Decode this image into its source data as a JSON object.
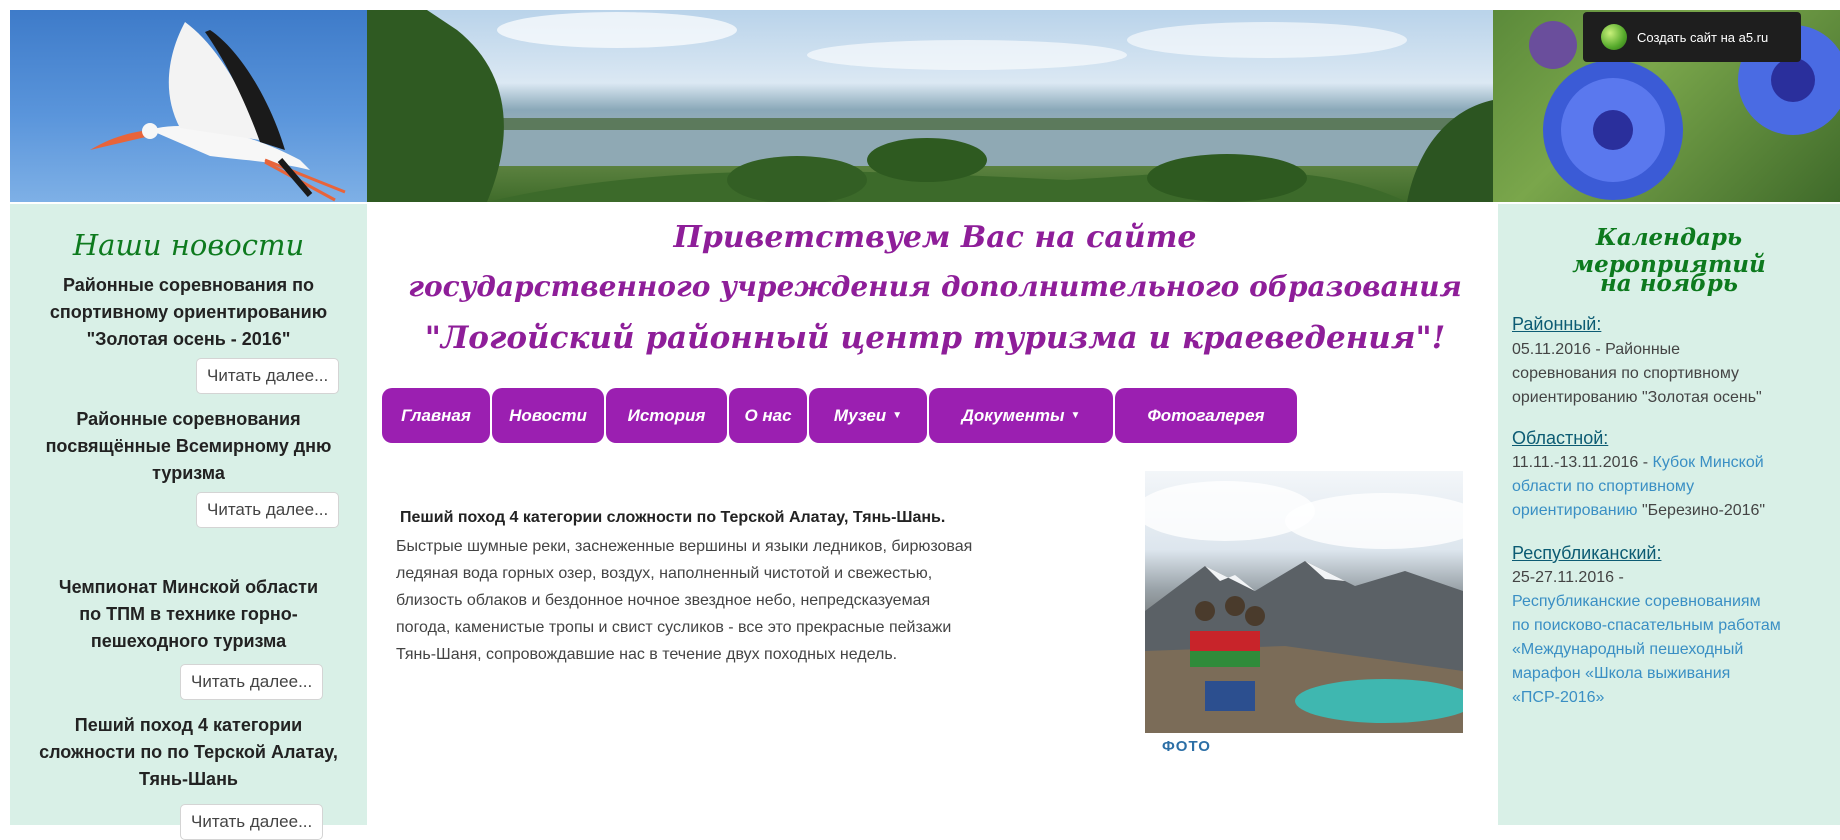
{
  "header": {
    "create_site_label": "Создать сайт на a5.ru"
  },
  "left": {
    "title": "Наши новости",
    "read_more": "Читать далее...",
    "news": [
      {
        "line1": "Районные соревнования по",
        "line2": "спортивному ориентированию",
        "line3": "\"Золотая осень - 2016\""
      },
      {
        "line1": "Районные соревнования",
        "line2": "посвящённые Всемирному дню",
        "line3": "туризма"
      },
      {
        "line1": "Чемпионат Минской области",
        "line2": "по ТПМ в технике горно-",
        "line3": "пешеходного туризма"
      },
      {
        "line1": "Пеший поход 4 категории",
        "line2": "сложности по по Терской Алатау,",
        "line3": "Тянь-Шань"
      }
    ]
  },
  "welcome": {
    "line1": "Приветствуем Вас на  сайте",
    "line2": "государственного учреждения дополнительного образования",
    "line3": "\"Логойский районный центр туризма и краеведения\"!"
  },
  "nav": {
    "items": [
      {
        "label": "Главная"
      },
      {
        "label": "Новости"
      },
      {
        "label": "История"
      },
      {
        "label": "О нас"
      },
      {
        "label": "Музеи"
      },
      {
        "label": "Документы"
      },
      {
        "label": "Фотогалерея"
      }
    ]
  },
  "article": {
    "title": "Пеший поход 4 категории сложности по Терской Алатау, Тянь-Шань.",
    "lines": [
      "Быстрые шумные реки, заснеженные вершины и языки ледников, бирюзовая",
      "ледяная вода горных озер, воздух, наполненный чистотой и свежестью,",
      "близость облаков и бездонное ночное звездное небо, непредсказуемая",
      "погода, каменистые тропы и свист сусликов - все это прекрасные пейзажи",
      "Тянь-Шаня, сопровождавшие нас в течение двух походных недель."
    ],
    "photo_caption": "ФОТО"
  },
  "calendar": {
    "title_line1": "Календарь мероприятий",
    "title_line2": "на ноябрь",
    "sections": [
      {
        "heading": "Районный:",
        "lines": [
          {
            "text": "05.11.2016 - Районные",
            "link": ""
          },
          {
            "text": "соревнования по спортивному",
            "link": ""
          },
          {
            "text": "ориентированию \"Золотая осень\"",
            "link": ""
          }
        ]
      },
      {
        "heading": "Областной:",
        "lines": [
          {
            "text": "11.11.-13.11.2016 -  ",
            "link": "Кубок Минской"
          },
          {
            "text": "",
            "link": "области по спортивному"
          },
          {
            "text": "",
            "link": "ориентированию",
            "tail": " \"Березино-2016\""
          }
        ]
      },
      {
        "heading": "Республиканский:",
        "lines": [
          {
            "text": "25-27.11.2016 -",
            "link": ""
          },
          {
            "text": "",
            "link": "Республиканские соревнованиям"
          },
          {
            "text": "",
            "link": "по поисково-спасательным работам"
          },
          {
            "text": "",
            "link": "«Международный пешеходный"
          },
          {
            "text": "",
            "link": "марафон «Школа выживания"
          },
          {
            "text": "",
            "link": "«ПСР-2016»"
          }
        ]
      }
    ]
  },
  "colors": {
    "accent_purple": "#9b1fb1",
    "title_green": "#0d7a1e",
    "sidebar_bg": "#d9f0e7",
    "link_blue": "#3a8fc4"
  }
}
